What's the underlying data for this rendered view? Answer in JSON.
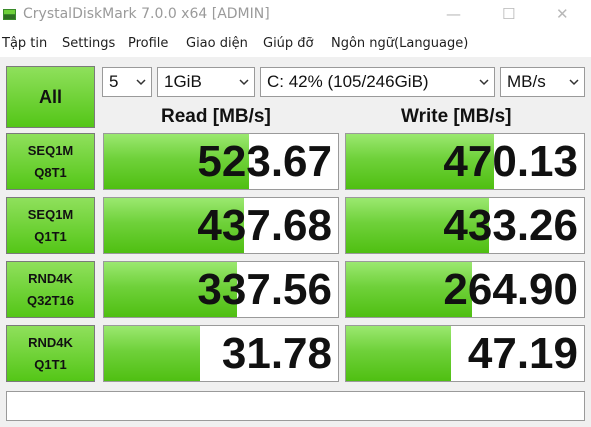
{
  "window": {
    "title": "CrystalDiskMark 7.0.0 x64 [ADMIN]",
    "minimize_glyph": "—",
    "maximize_glyph": "☐",
    "close_glyph": "✕"
  },
  "menu": {
    "items": [
      "Tập tin",
      "Settings",
      "Profile",
      "Giao diện",
      "Giúp đỡ",
      "Ngôn ngữ(Language)"
    ]
  },
  "controls": {
    "all_label": "All",
    "count": "5",
    "size": "1GiB",
    "drive": "C: 42% (105/246GiB)",
    "unit": "MB/s"
  },
  "headers": {
    "read": "Read [MB/s]",
    "write": "Write [MB/s]"
  },
  "tests": [
    {
      "line1": "SEQ1M",
      "line2": "Q8T1",
      "read": "523.67",
      "write": "470.13",
      "read_fill": 0.62,
      "write_fill": 0.62
    },
    {
      "line1": "SEQ1M",
      "line2": "Q1T1",
      "read": "437.68",
      "write": "433.26",
      "read_fill": 0.6,
      "write_fill": 0.6
    },
    {
      "line1": "RND4K",
      "line2": "Q32T16",
      "read": "337.56",
      "write": "264.90",
      "read_fill": 0.57,
      "write_fill": 0.53
    },
    {
      "line1": "RND4K",
      "line2": "Q1T1",
      "read": "31.78",
      "write": "47.19",
      "read_fill": 0.41,
      "write_fill": 0.44
    }
  ],
  "comment": "",
  "colors": {
    "accent_green": "#54c617",
    "bar_green": "#6fd13a"
  }
}
